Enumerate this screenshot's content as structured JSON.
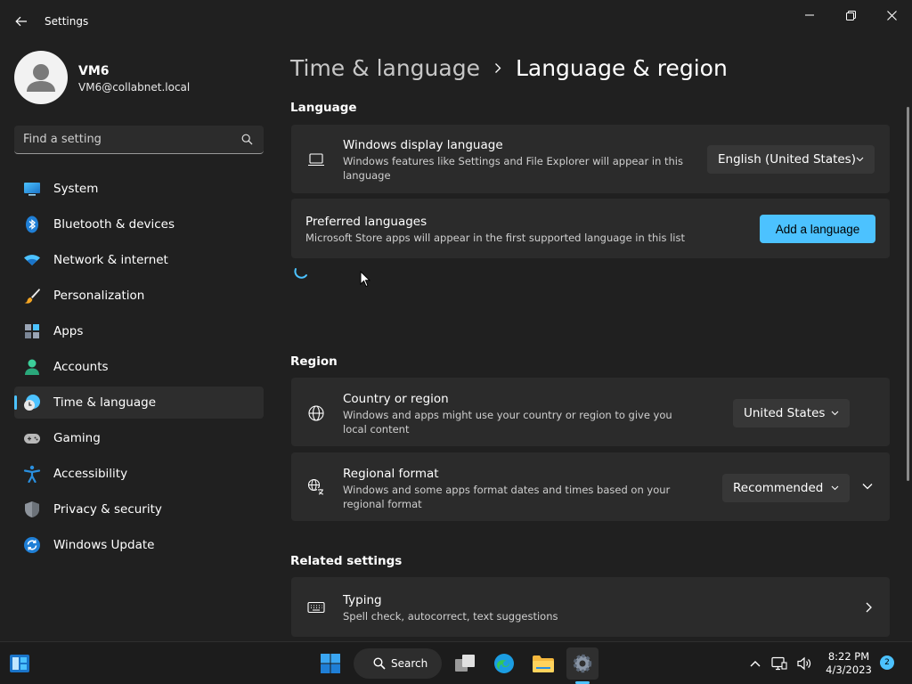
{
  "window": {
    "app_title": "Settings",
    "back_icon": "back-arrow-icon",
    "minimize_icon": "minimize-icon",
    "restore_icon": "restore-icon",
    "close_icon": "close-icon"
  },
  "profile": {
    "name": "VM6",
    "email": "VM6@collabnet.local",
    "avatar_icon": "user-avatar-icon"
  },
  "search": {
    "placeholder": "Find a setting",
    "icon": "search-icon"
  },
  "sidebar": {
    "items": [
      {
        "label": "System",
        "icon": "system-icon",
        "active": false
      },
      {
        "label": "Bluetooth & devices",
        "icon": "bluetooth-icon",
        "active": false
      },
      {
        "label": "Network & internet",
        "icon": "wifi-icon",
        "active": false
      },
      {
        "label": "Personalization",
        "icon": "paintbrush-icon",
        "active": false
      },
      {
        "label": "Apps",
        "icon": "apps-icon",
        "active": false
      },
      {
        "label": "Accounts",
        "icon": "accounts-icon",
        "active": false
      },
      {
        "label": "Time & language",
        "icon": "clock-globe-icon",
        "active": true
      },
      {
        "label": "Gaming",
        "icon": "gamepad-icon",
        "active": false
      },
      {
        "label": "Accessibility",
        "icon": "accessibility-icon",
        "active": false
      },
      {
        "label": "Privacy & security",
        "icon": "shield-icon",
        "active": false
      },
      {
        "label": "Windows Update",
        "icon": "update-icon",
        "active": false
      }
    ]
  },
  "breadcrumb": {
    "parent": "Time & language",
    "current": "Language & region"
  },
  "language": {
    "section_title": "Language",
    "display_language": {
      "title": "Windows display language",
      "description": "Windows features like Settings and File Explorer will appear in this language",
      "value": "English (United States)",
      "icon": "laptop-icon"
    },
    "preferred": {
      "title": "Preferred languages",
      "description": "Microsoft Store apps will appear in the first supported language in this list",
      "button_label": "Add a language"
    },
    "loading_icon": "loading-spinner-icon"
  },
  "region": {
    "section_title": "Region",
    "country": {
      "title": "Country or region",
      "description": "Windows and apps might use your country or region to give you local content",
      "value": "United States",
      "icon": "globe-icon"
    },
    "format": {
      "title": "Regional format",
      "description": "Windows and some apps format dates and times based on your regional format",
      "value": "Recommended",
      "icon": "regional-format-icon"
    }
  },
  "related": {
    "section_title": "Related settings",
    "typing": {
      "title": "Typing",
      "description": "Spell check, autocorrect, text suggestions",
      "icon": "keyboard-icon"
    }
  },
  "taskbar": {
    "search_label": "Search",
    "time": "8:22 PM",
    "date": "4/3/2023",
    "notification_count": "2"
  },
  "colors": {
    "accent": "#4cc2ff",
    "background": "#202020",
    "card": "#2b2b2b"
  }
}
